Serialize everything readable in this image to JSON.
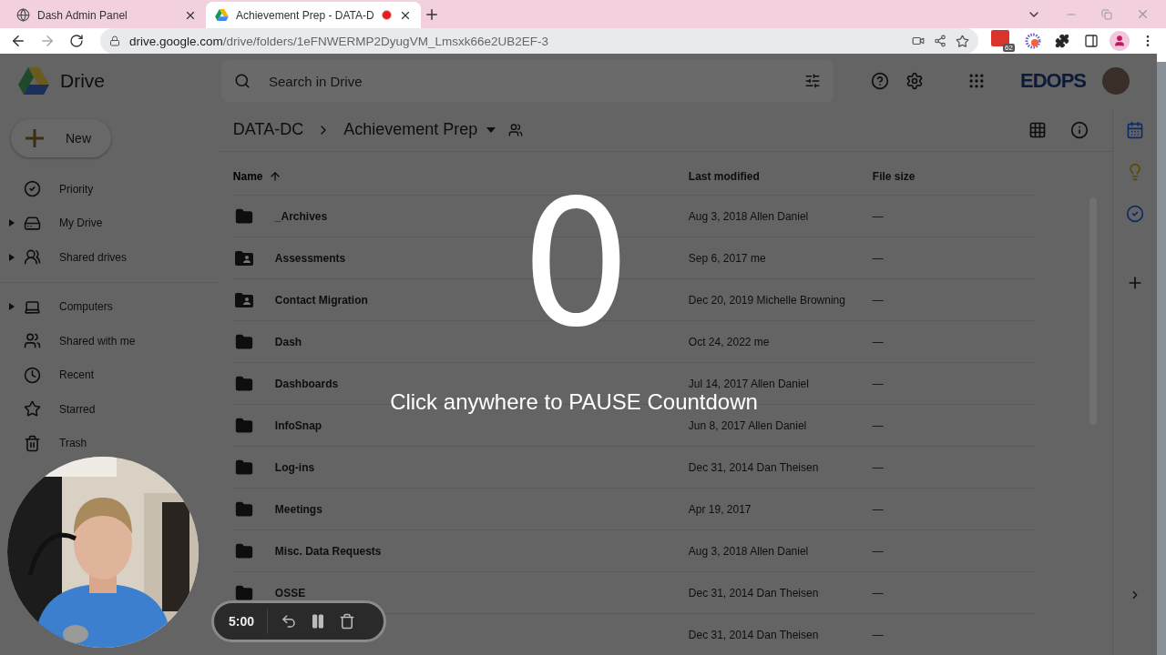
{
  "browser": {
    "tabs": [
      {
        "title": "Dash Admin Panel",
        "selected": false,
        "recording": false
      },
      {
        "title": "Achievement Prep - DATA-D",
        "selected": true,
        "recording": true
      }
    ],
    "url": {
      "host": "drive.google.com",
      "path": "/drive/folders/1eFNWERMP2DyugVM_Lmsxk66e2UB2EF-3"
    },
    "extension_badge": "62"
  },
  "drive": {
    "app_name": "Drive",
    "new_button": "New",
    "search": {
      "placeholder": "Search in Drive"
    },
    "org_logo": "EDOPS",
    "sidebar": {
      "sections": [
        [
          {
            "label": "Priority",
            "kind": "priority",
            "expandable": false
          },
          {
            "label": "My Drive",
            "kind": "my_drive",
            "expandable": true
          },
          {
            "label": "Shared drives",
            "kind": "shared_drives",
            "expandable": true
          }
        ],
        [
          {
            "label": "Computers",
            "kind": "computers",
            "expandable": true
          },
          {
            "label": "Shared with me",
            "kind": "shared",
            "expandable": false
          },
          {
            "label": "Recent",
            "kind": "recent",
            "expandable": false
          },
          {
            "label": "Starred",
            "kind": "starred",
            "expandable": false
          },
          {
            "label": "Trash",
            "kind": "trash",
            "expandable": false
          }
        ]
      ]
    },
    "breadcrumb": [
      "DATA-DC",
      "Achievement Prep"
    ],
    "table": {
      "columns": [
        {
          "label": "Name",
          "sorted": true
        },
        {
          "label": "Last modified",
          "sorted": false
        },
        {
          "label": "File size",
          "sorted": false
        }
      ],
      "rows": [
        {
          "kind": "folder",
          "name": "_Archives",
          "modified": "Aug 3, 2018",
          "owner": "Allen Daniel",
          "size": "—"
        },
        {
          "kind": "shared_folder",
          "name": "Assessments",
          "modified": "Sep 6, 2017",
          "owner": "me",
          "size": "—"
        },
        {
          "kind": "shared_folder",
          "name": "Contact Migration",
          "modified": "Dec 20, 2019",
          "owner": "Michelle Browning",
          "size": "—"
        },
        {
          "kind": "folder",
          "name": "Dash",
          "modified": "Oct 24, 2022",
          "owner": "me",
          "size": "—"
        },
        {
          "kind": "folder",
          "name": "Dashboards",
          "modified": "Jul 14, 2017",
          "owner": "Allen Daniel",
          "size": "—"
        },
        {
          "kind": "folder",
          "name": "InfoSnap",
          "modified": "Jun 8, 2017",
          "owner": "Allen Daniel",
          "size": "—"
        },
        {
          "kind": "folder",
          "name": "Log-ins",
          "modified": "Dec 31, 2014",
          "owner": "Dan Theisen",
          "size": "—"
        },
        {
          "kind": "folder",
          "name": "Meetings",
          "modified": "Apr 19, 2017",
          "size": "—"
        },
        {
          "kind": "folder",
          "name": "Misc. Data Requests",
          "modified": "Aug 3, 2018",
          "owner": "Allen Daniel",
          "size": "—"
        },
        {
          "kind": "folder",
          "name": "OSSE",
          "modified": "Dec 31, 2014",
          "owner": "Dan Theisen",
          "size": "—"
        },
        {
          "kind": "hidden",
          "modified": "Dec 31, 2014",
          "owner": "Dan Theisen",
          "size": "—"
        }
      ]
    }
  },
  "overlay": {
    "countdown": "0",
    "message": "Click anywhere to PAUSE Countdown"
  },
  "timer": {
    "time": "5:00"
  }
}
